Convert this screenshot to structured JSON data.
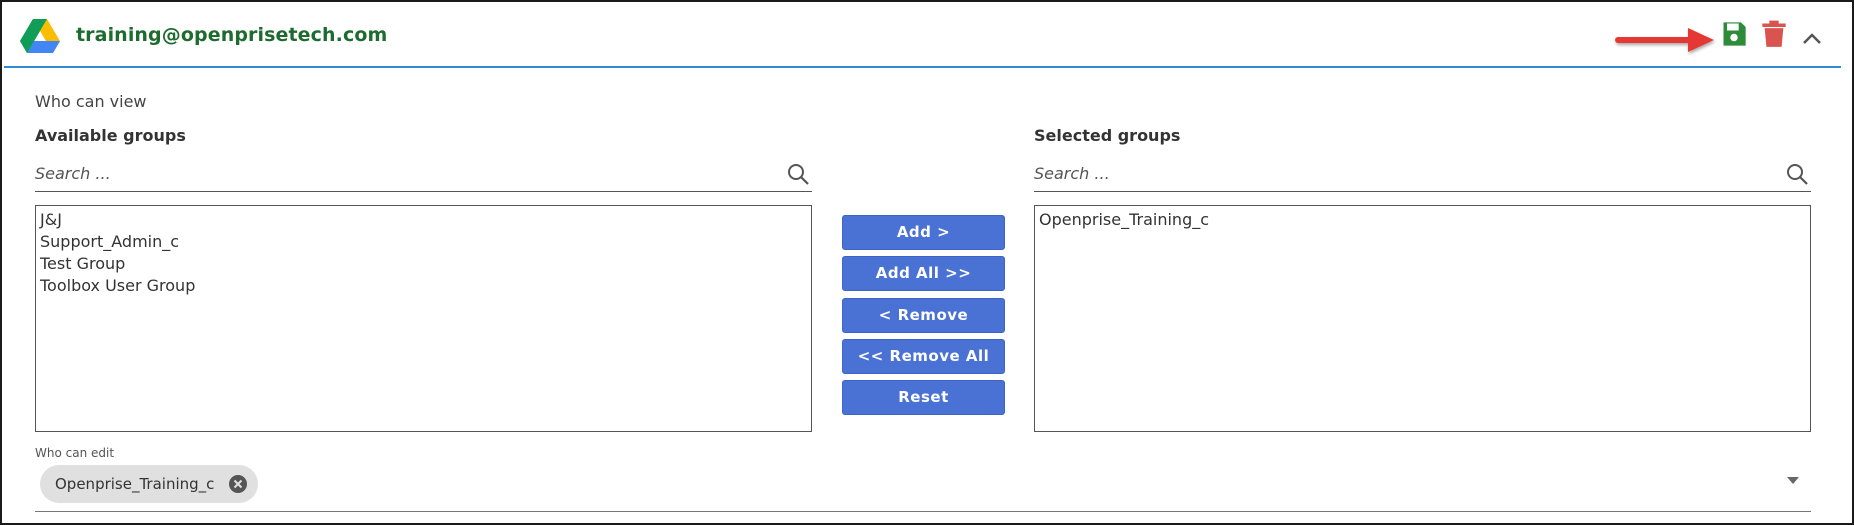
{
  "header": {
    "account": "training@openprisetech.com",
    "icons": {
      "logo": "google-drive-icon",
      "save": "save-icon",
      "delete": "trash-icon",
      "collapse": "chevron-up-icon"
    }
  },
  "view": {
    "label": "Who can view",
    "available": {
      "heading": "Available groups",
      "search_placeholder": "Search ...",
      "items": [
        "J&J",
        "Support_Admin_c",
        "Test Group",
        "Toolbox User Group"
      ]
    },
    "selected": {
      "heading": "Selected groups",
      "search_placeholder": "Search ...",
      "items": [
        "Openprise_Training_c"
      ]
    },
    "buttons": {
      "add": "Add >",
      "add_all": "Add All >>",
      "remove": "< Remove",
      "remove_all": "<< Remove All",
      "reset": "Reset"
    }
  },
  "edit": {
    "label": "Who can edit",
    "chips": [
      "Openprise_Training_c"
    ]
  },
  "colors": {
    "accent_blue": "#4a72d4",
    "header_rule": "#2e8bd8",
    "account_green": "#1e6b2f",
    "save_green": "#2e8b3a",
    "delete_red": "#d9534f",
    "annotation_arrow": "#e53935"
  }
}
